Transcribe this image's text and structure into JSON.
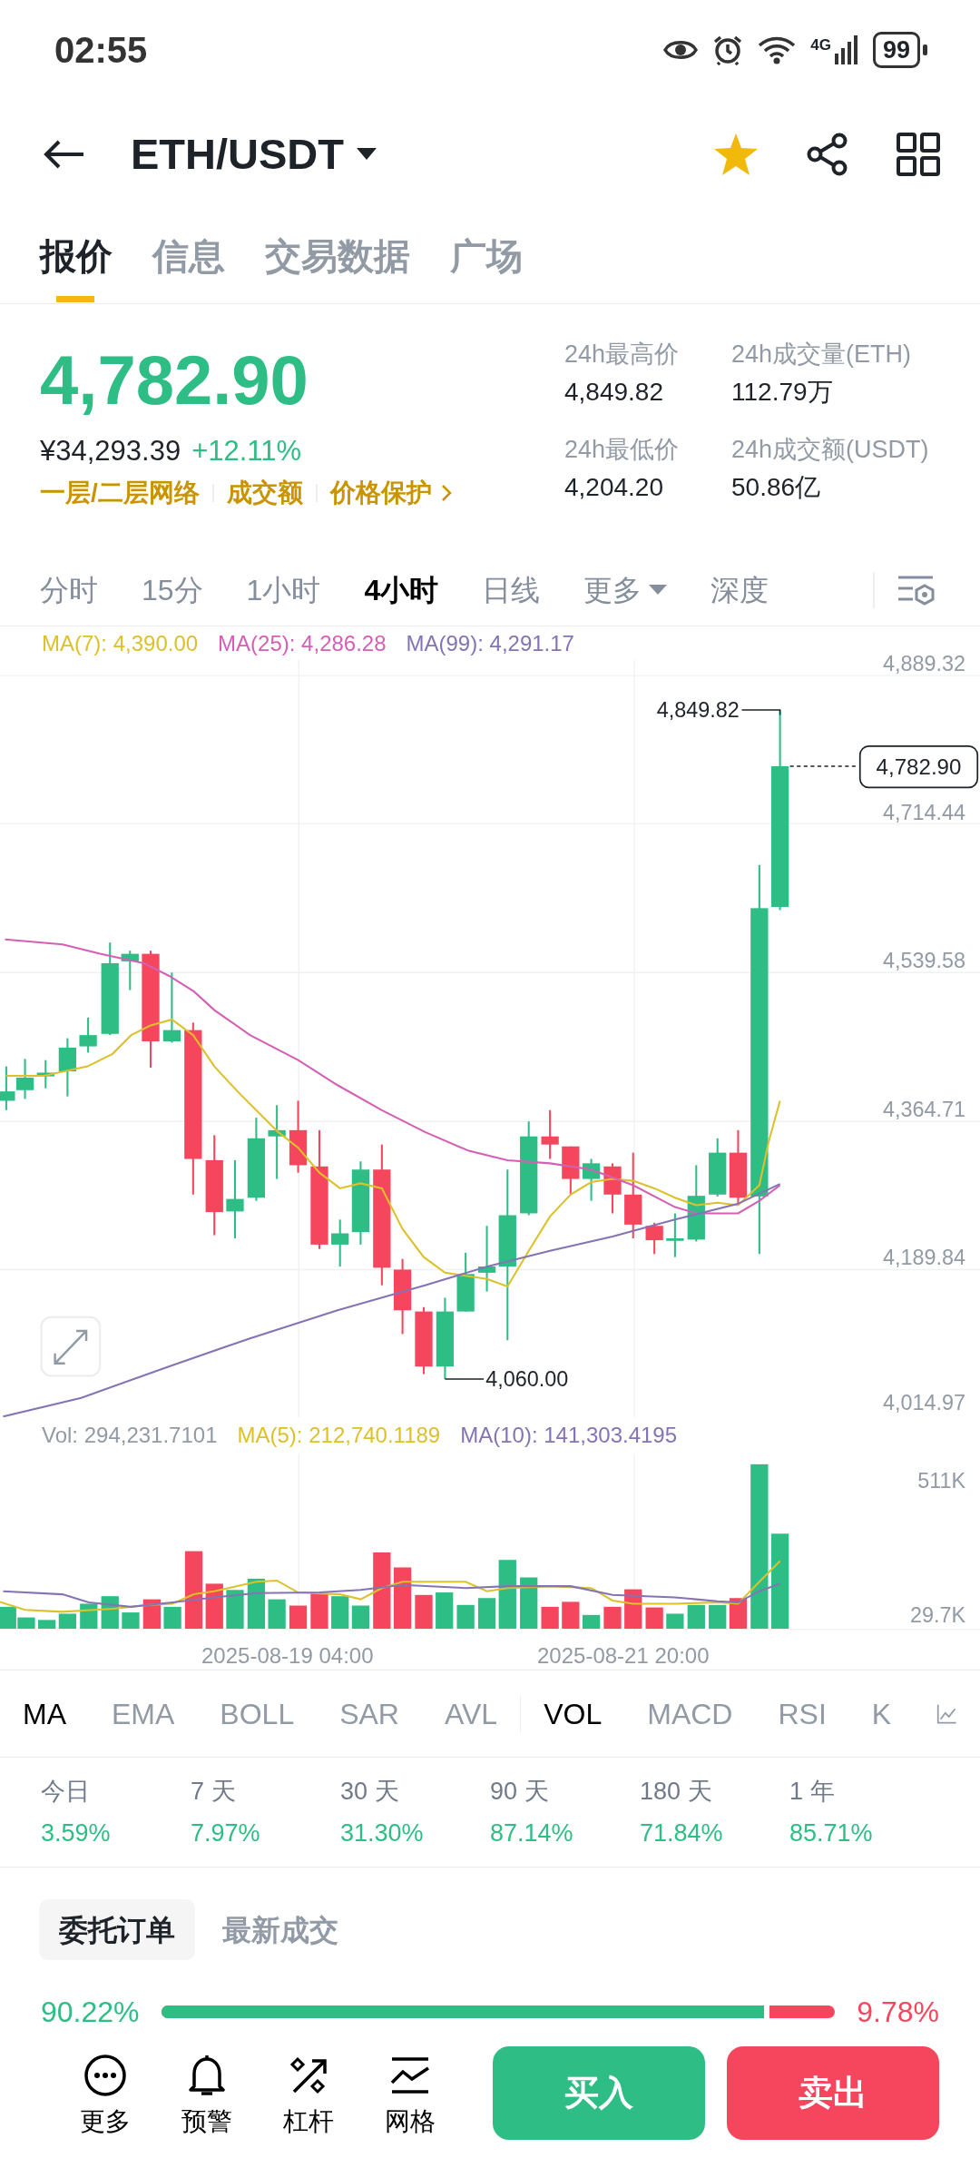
{
  "status_bar": {
    "time": "02:55",
    "network": "4G",
    "battery": "99"
  },
  "header": {
    "title": "ETH/USDT",
    "favorite": true
  },
  "tabs": [
    {
      "label": "报价",
      "selected": true
    },
    {
      "label": "信息",
      "selected": false
    },
    {
      "label": "交易数据",
      "selected": false
    },
    {
      "label": "广场",
      "selected": false
    }
  ],
  "price": {
    "last": "4,782.90",
    "cny": "¥34,293.39",
    "change": "+12.11%",
    "links": [
      "一层/二层网络",
      "成交额",
      "价格保护"
    ]
  },
  "stats": [
    {
      "label": "24h最高价",
      "value": "4,849.82"
    },
    {
      "label": "24h成交量(ETH)",
      "value": "112.79万"
    },
    {
      "label": "24h最低价",
      "value": "4,204.20"
    },
    {
      "label": "24h成交额(USDT)",
      "value": "50.86亿"
    }
  ],
  "intervals": [
    {
      "label": "分时",
      "kind": "tab",
      "selected": false
    },
    {
      "label": "15分",
      "kind": "tab",
      "selected": false
    },
    {
      "label": "1小时",
      "kind": "tab",
      "selected": false
    },
    {
      "label": "4小时",
      "kind": "tab",
      "selected": true
    },
    {
      "label": "日线",
      "kind": "tab",
      "selected": false
    },
    {
      "label": "更多",
      "kind": "dropdown",
      "selected": false
    },
    {
      "label": "深度",
      "kind": "tab",
      "selected": false
    }
  ],
  "chart": {
    "ma_legend": [
      {
        "text": "MA(7): 4,390.00",
        "color": "#dcc12a"
      },
      {
        "text": "MA(25): 4,286.28",
        "color": "#d55fb5"
      },
      {
        "text": "MA(99): 4,291.17",
        "color": "#8474b4"
      }
    ],
    "price_ticks": [
      "4,889.32",
      "4,714.44",
      "4,539.58",
      "4,364.71",
      "4,189.84",
      "4,014.97"
    ],
    "high_label": "4,849.82",
    "low_label": "4,060.00",
    "last_price": "4,782.90"
  },
  "volume": {
    "legend": [
      {
        "text": "Vol: 294,231.7101",
        "color": "#929aa5"
      },
      {
        "text": "MA(5): 212,740.1189",
        "color": "#dcc12a"
      },
      {
        "text": "MA(10): 141,303.4195",
        "color": "#8474b4"
      }
    ],
    "ticks": [
      "511K",
      "29.7K"
    ],
    "dates": [
      "2025-08-19 04:00",
      "2025-08-21 20:00"
    ]
  },
  "indicators": [
    {
      "label": "MA",
      "selected": true
    },
    {
      "label": "EMA",
      "selected": false
    },
    {
      "label": "BOLL",
      "selected": false
    },
    {
      "label": "SAR",
      "selected": false
    },
    {
      "label": "AVL",
      "selected": false
    },
    {
      "label": "VOL",
      "selected": true
    },
    {
      "label": "MACD",
      "selected": false
    },
    {
      "label": "RSI",
      "selected": false
    },
    {
      "label": "K",
      "selected": false
    }
  ],
  "periods": [
    {
      "label": "今日",
      "value": "3.59%"
    },
    {
      "label": "7 天",
      "value": "7.97%"
    },
    {
      "label": "30 天",
      "value": "31.30%"
    },
    {
      "label": "90 天",
      "value": "87.14%"
    },
    {
      "label": "180 天",
      "value": "71.84%"
    },
    {
      "label": "1 年",
      "value": "85.71%"
    }
  ],
  "order_tabs": [
    {
      "label": "委托订单",
      "selected": true
    },
    {
      "label": "最新成交",
      "selected": false
    }
  ],
  "order_ratio": {
    "buy": "90.22%",
    "sell": "9.78%",
    "level": 0.9022
  },
  "bottom_bar": {
    "tools": [
      {
        "label": "更多",
        "kind": "more"
      },
      {
        "label": "预警",
        "kind": "alert"
      },
      {
        "label": "杠杆",
        "kind": "leverage"
      },
      {
        "label": "网格",
        "kind": "grid"
      }
    ],
    "buy": "买入",
    "sell": "卖出"
  }
}
